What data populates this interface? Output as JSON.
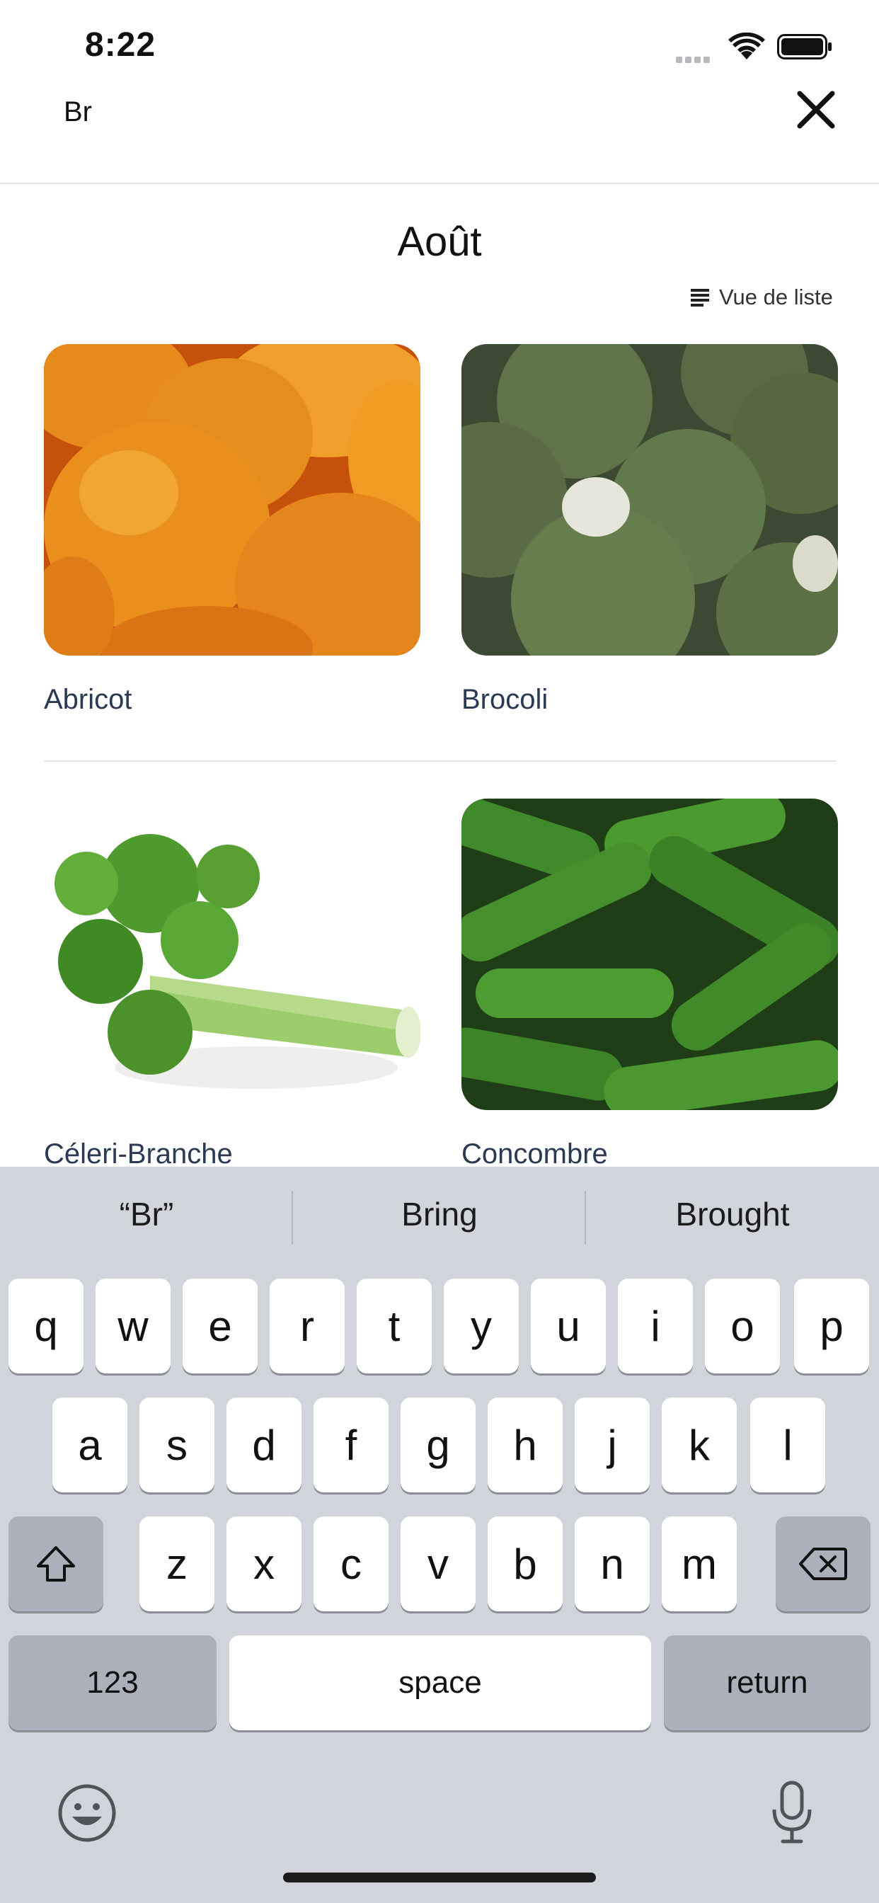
{
  "status_bar": {
    "time": "8:22"
  },
  "search": {
    "value": "Br"
  },
  "header": {
    "month_title": "Août",
    "list_view_label": "Vue de liste"
  },
  "items": [
    {
      "name": "Abricot"
    },
    {
      "name": "Brocoli"
    },
    {
      "name": "Céleri-Branche"
    },
    {
      "name": "Concombre"
    }
  ],
  "keyboard": {
    "suggestions": [
      "“Br”",
      "Bring",
      "Brought"
    ],
    "row1": [
      "q",
      "w",
      "e",
      "r",
      "t",
      "y",
      "u",
      "i",
      "o",
      "p"
    ],
    "row2": [
      "a",
      "s",
      "d",
      "f",
      "g",
      "h",
      "j",
      "k",
      "l"
    ],
    "row3": [
      "z",
      "x",
      "c",
      "v",
      "b",
      "n",
      "m"
    ],
    "numbers_label": "123",
    "space_label": "space",
    "return_label": "return"
  },
  "colors": {
    "background": "#ffffff",
    "keyboard_bg": "#d1d4da",
    "label_text": "#2b3a52"
  }
}
